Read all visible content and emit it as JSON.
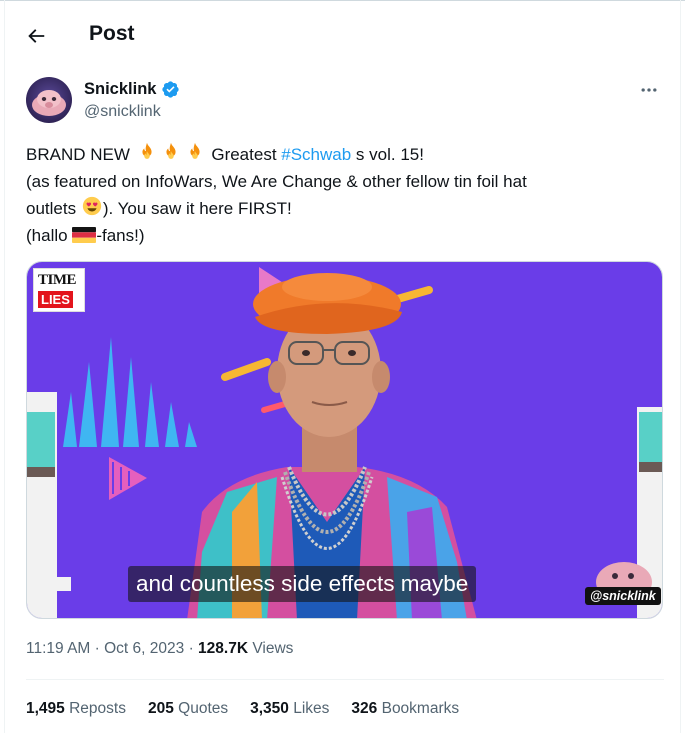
{
  "header": {
    "title": "Post"
  },
  "author": {
    "display_name": "Snicklink",
    "handle": "@snicklink",
    "verified": true
  },
  "tweet": {
    "line1_pre": "BRAND NEW ",
    "line1_mid": " Greatest ",
    "hashtag": "#Schwab",
    "line1_post": " s vol. 15!",
    "line2": "(as featured on InfoWars, We Are Change & other fellow tin foil hat",
    "line3_pre": "outlets ",
    "line3_post": "). You saw it here FIRST!",
    "line4_pre": "(hallo ",
    "line4_post": "-fans!)"
  },
  "media": {
    "subtitle": "and countless side effects maybe",
    "watermark": "@snicklink",
    "logo_top": "TIME",
    "logo_bottom": "LIES"
  },
  "meta": {
    "time": "11:19 AM",
    "sep1": " · ",
    "date": "Oct 6, 2023",
    "sep2": " · ",
    "views_count": "128.7K",
    "views_label": " Views"
  },
  "stats": {
    "reposts_count": "1,495",
    "reposts_label": " Reposts",
    "quotes_count": "205",
    "quotes_label": " Quotes",
    "likes_count": "3,350",
    "likes_label": " Likes",
    "bookmarks_count": "326",
    "bookmarks_label": " Bookmarks"
  },
  "colors": {
    "link": "#1d9bf0",
    "text": "#0f1419",
    "secondary": "#536471",
    "verified": "#1d9bf0",
    "media_bg": "#6a3de8"
  },
  "icons": {
    "back": "arrow-left-icon",
    "verified": "verified-badge-icon",
    "more": "more-horizontal-icon",
    "fire": "fire-emoji",
    "heart_eyes": "heart-eyes-emoji",
    "germany_flag": "germany-flag-emoji"
  }
}
